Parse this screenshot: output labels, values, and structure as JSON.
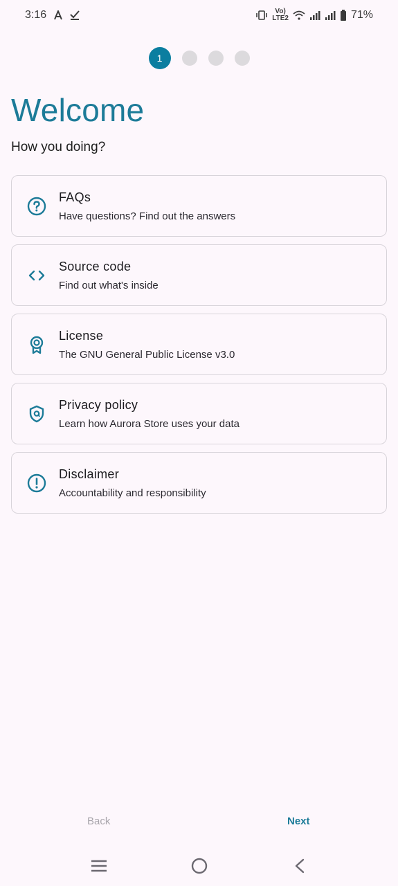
{
  "status_bar": {
    "time": "3:16",
    "network_label": "Vo)",
    "network_sub": "LTE2",
    "battery": "71%",
    "icons": [
      "font-a-icon",
      "download-check-icon",
      "vibrate-icon",
      "wifi-icon",
      "signal-icon",
      "signal-icon-2",
      "battery-icon"
    ]
  },
  "stepper": {
    "steps": [
      "1",
      "",
      "",
      ""
    ],
    "active_index": 0
  },
  "header": {
    "title": "Welcome",
    "subtitle": "How you doing?"
  },
  "cards": [
    {
      "icon": "help-circle-icon",
      "title": "FAQs",
      "subtitle": "Have questions? Find out the answers"
    },
    {
      "icon": "code-icon",
      "title": "Source code",
      "subtitle": "Find out what's inside"
    },
    {
      "icon": "license-badge-icon",
      "title": "License",
      "subtitle": "The GNU General Public License v3.0"
    },
    {
      "icon": "privacy-shield-icon",
      "title": "Privacy policy",
      "subtitle": "Learn how Aurora Store uses your data"
    },
    {
      "icon": "alert-circle-icon",
      "title": "Disclaimer",
      "subtitle": "Accountability and responsibility"
    }
  ],
  "actions": {
    "back_label": "Back",
    "next_label": "Next"
  },
  "nav": {
    "icons": [
      "recents-icon",
      "home-icon",
      "back-nav-icon"
    ]
  },
  "colors": {
    "accent": "#1c7b98",
    "step_active": "#0b7ea0",
    "step_inactive": "#dcdadd",
    "background": "#fdf7fc",
    "card_border": "#d8d4da"
  }
}
